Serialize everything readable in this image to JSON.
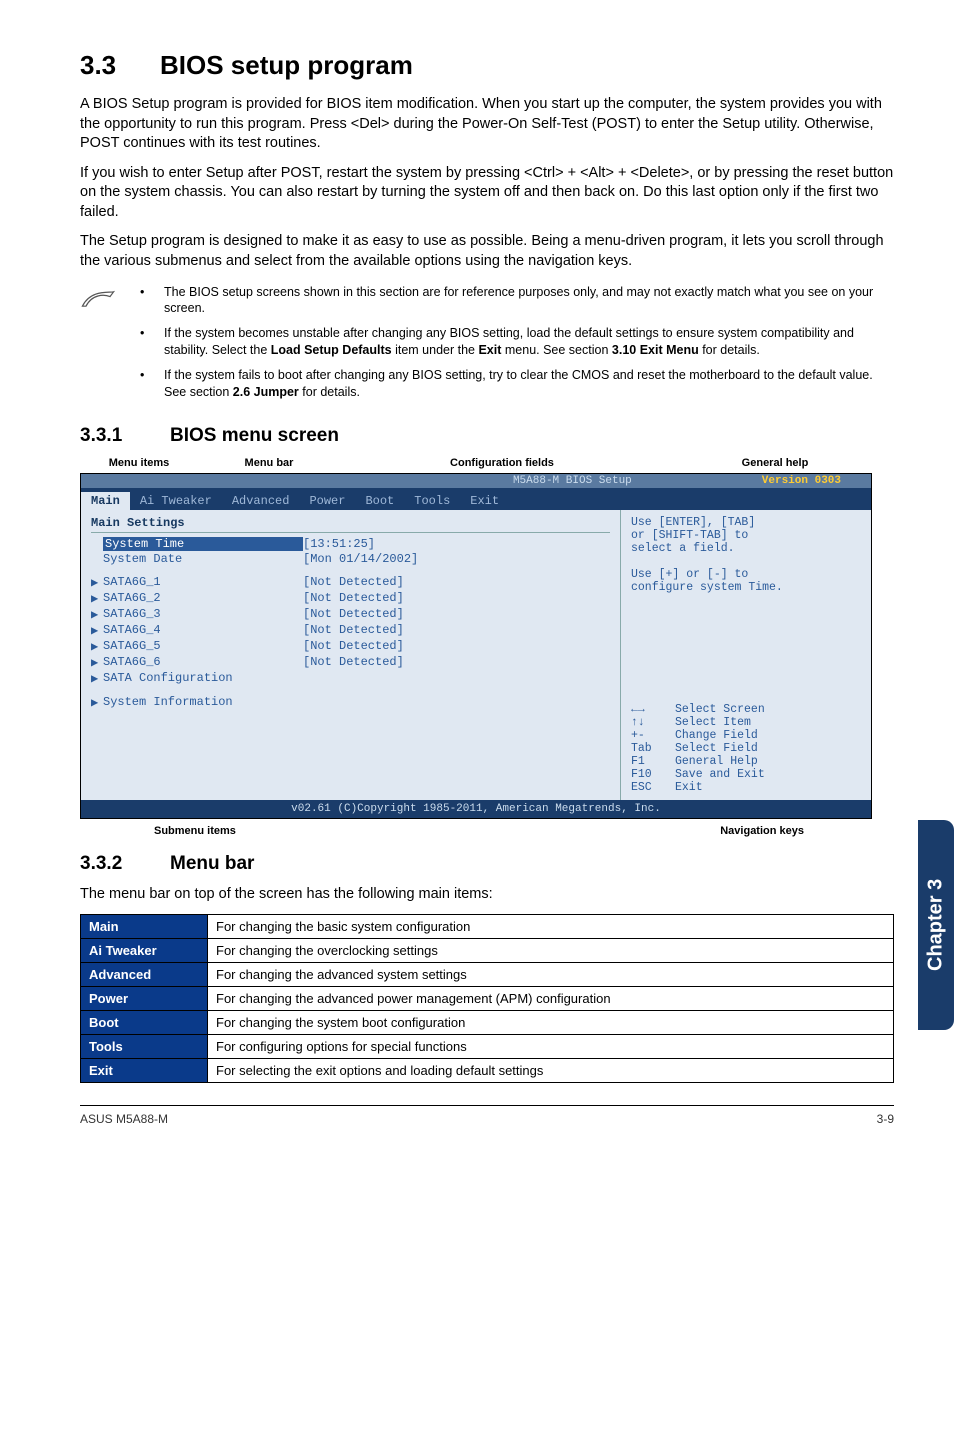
{
  "section": {
    "num": "3.3",
    "title": "BIOS setup program"
  },
  "para1": "A BIOS Setup program is provided for BIOS item modification. When you start up the computer, the system provides you with the opportunity to run this program. Press <Del> during the Power-On Self-Test (POST) to enter the Setup utility. Otherwise, POST continues with its test routines.",
  "para2": "If you wish to enter Setup after POST, restart the system by pressing <Ctrl> + <Alt> + <Delete>, or by pressing the reset button on the system chassis. You can also restart by turning the system off and then back on. Do this last option only if the first two failed.",
  "para3": "The Setup program is designed to make it as easy to use as possible. Being a menu-driven program, it lets you scroll through the various submenus and select from the available options using the navigation keys.",
  "notes": [
    "The BIOS setup screens shown in this section are for reference purposes only, and may not exactly match what you see on your screen.",
    "If the system becomes unstable after changing any BIOS setting, load the default settings to ensure system compatibility and stability. Select the <b>Load Setup Defaults</b> item under the <b>Exit</b> menu. See section <b>3.10 Exit Menu</b> for details.",
    "If the system fails to boot after changing any BIOS setting, try to clear the CMOS and reset the motherboard to the default value. See section <b>2.6 Jumper</b> for details."
  ],
  "sub1": {
    "num": "3.3.1",
    "title": "BIOS menu screen"
  },
  "bios_top_labels": [
    "Menu items",
    "Menu bar",
    "Configuration fields",
    "General help"
  ],
  "bios": {
    "title": "M5A88-M BIOS Setup",
    "version": "Version 0303",
    "tabs": [
      "Main",
      "Ai Tweaker",
      "Advanced",
      "Power",
      "Boot",
      "Tools",
      "Exit"
    ],
    "active_tab": "Main",
    "group": "Main Settings",
    "rows": [
      {
        "label": "System Time",
        "value": "[13:51:25]",
        "selected": true
      },
      {
        "label": "System Date",
        "value": "[Mon 01/14/2002]"
      }
    ],
    "sata": [
      {
        "label": "SATA6G_1",
        "value": "[Not Detected]"
      },
      {
        "label": "SATA6G_2",
        "value": "[Not Detected]"
      },
      {
        "label": "SATA6G_3",
        "value": "[Not Detected]"
      },
      {
        "label": "SATA6G_4",
        "value": "[Not Detected]"
      },
      {
        "label": "SATA6G_5",
        "value": "[Not Detected]"
      },
      {
        "label": "SATA6G_6",
        "value": "[Not Detected]"
      }
    ],
    "extra": [
      "SATA Configuration",
      "System Information"
    ],
    "help": [
      "Use [ENTER], [TAB]",
      "or [SHIFT-TAB] to",
      "select a field.",
      "",
      "Use [+] or [-] to",
      "configure system Time."
    ],
    "keys": [
      {
        "k": "←→",
        "d": "Select Screen"
      },
      {
        "k": "↑↓",
        "d": "Select Item"
      },
      {
        "k": "+-",
        "d": "Change Field"
      },
      {
        "k": "Tab",
        "d": "Select Field"
      },
      {
        "k": "F1",
        "d": "General Help"
      },
      {
        "k": "F10",
        "d": "Save and Exit"
      },
      {
        "k": "ESC",
        "d": "Exit"
      }
    ],
    "footer": "v02.61 (C)Copyright 1985-2011, American Megatrends, Inc."
  },
  "below_labels": {
    "left": "Submenu items",
    "right": "Navigation keys"
  },
  "sub2": {
    "num": "3.3.2",
    "title": "Menu bar"
  },
  "menubar_intro": "The menu bar on top of the screen has the following main items:",
  "menubar_rows": [
    {
      "h": "Main",
      "d": "For changing the basic system configuration"
    },
    {
      "h": "Ai Tweaker",
      "d": "For changing the overclocking settings"
    },
    {
      "h": "Advanced",
      "d": "For changing the advanced system settings"
    },
    {
      "h": "Power",
      "d": "For changing the advanced power management (APM) configuration"
    },
    {
      "h": "Boot",
      "d": "For changing the system boot configuration"
    },
    {
      "h": "Tools",
      "d": "For configuring options for special functions"
    },
    {
      "h": "Exit",
      "d": "For selecting the exit options and loading default settings"
    }
  ],
  "side_tab": "Chapter 3",
  "footer": {
    "left": "ASUS M5A88-M",
    "right": "3-9"
  }
}
